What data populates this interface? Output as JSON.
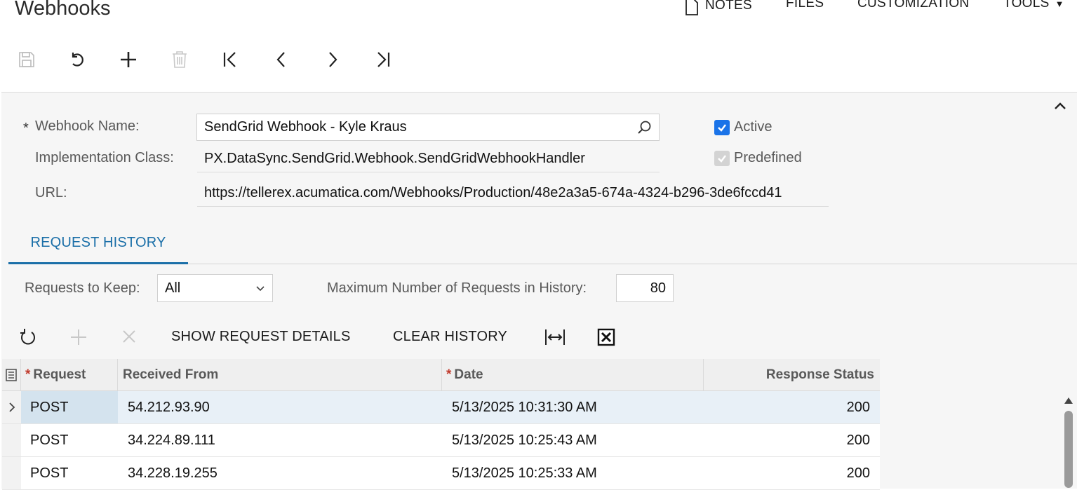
{
  "title": "Webhooks",
  "top_menu": {
    "notes": "NOTES",
    "files": "FILES",
    "customization": "CUSTOMIZATION",
    "tools": "TOOLS"
  },
  "toolbar_icons": [
    "save-icon",
    "undo-icon",
    "add-icon",
    "delete-icon",
    "first-record-icon",
    "previous-record-icon",
    "next-record-icon",
    "last-record-icon"
  ],
  "form": {
    "webhook_name_label": "Webhook Name:",
    "webhook_name_value": "SendGrid Webhook - Kyle Kraus",
    "impl_class_label": "Implementation Class:",
    "impl_class_value": "PX.DataSync.SendGrid.Webhook.SendGridWebhookHandler",
    "url_label": "URL:",
    "url_value": "https://tellerex.acumatica.com/Webhooks/Production/48e2a3a5-674a-4324-b296-3de6fccd41",
    "active_label": "Active",
    "active_checked": true,
    "predefined_label": "Predefined",
    "predefined_checked": true
  },
  "tab": {
    "label": "REQUEST HISTORY"
  },
  "history_settings": {
    "requests_to_keep_label": "Requests to Keep:",
    "requests_to_keep_value": "All",
    "max_requests_label": "Maximum Number of Requests in History:",
    "max_requests_value": "80"
  },
  "grid_toolbar": {
    "show_details": "SHOW REQUEST DETAILS",
    "clear_history": "CLEAR HISTORY"
  },
  "grid": {
    "columns": [
      "Request",
      "Received From",
      "Date",
      "Response Status"
    ],
    "rows": [
      {
        "request": "POST",
        "received_from": "54.212.93.90",
        "date": "5/13/2025 10:31:30 AM",
        "status": "200"
      },
      {
        "request": "POST",
        "received_from": "34.224.89.111",
        "date": "5/13/2025 10:25:43 AM",
        "status": "200"
      },
      {
        "request": "POST",
        "received_from": "34.228.19.255",
        "date": "5/13/2025 10:25:33 AM",
        "status": "200"
      }
    ]
  },
  "colors": {
    "accent": "#1b6fa8",
    "checkbox": "#1a73e8",
    "required_star": "#c0392b",
    "selected_row": "#e8f0f7"
  }
}
